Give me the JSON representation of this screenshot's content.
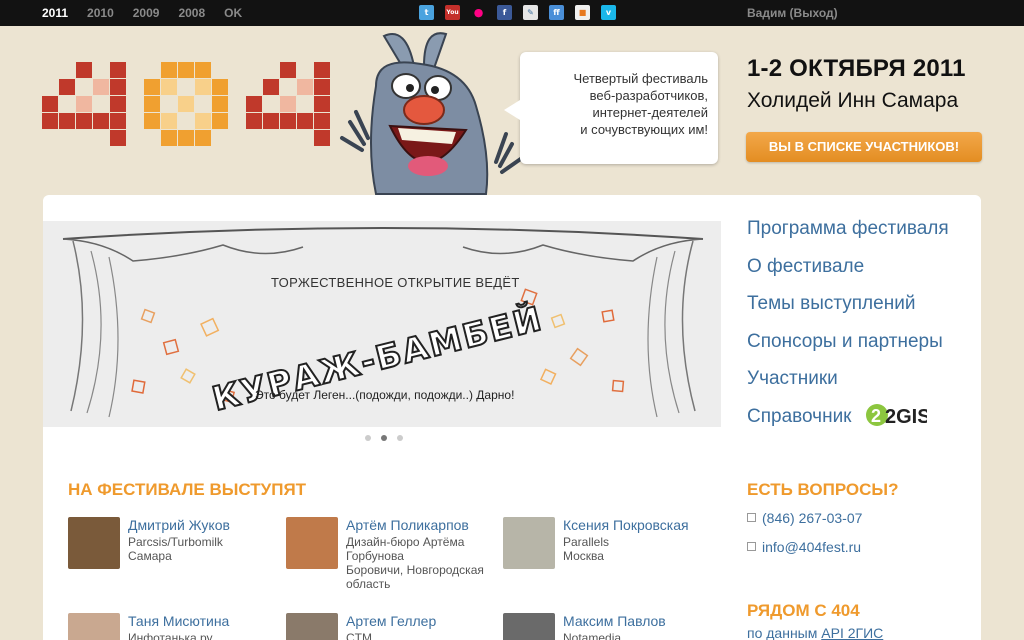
{
  "topbar": {
    "years": [
      "2011",
      "2010",
      "2009",
      "2008",
      "OK"
    ],
    "active_year": "2011",
    "social_icons": [
      "twitter-icon",
      "youtube-icon",
      "flickr-icon",
      "facebook-icon",
      "feather-icon",
      "friendfeed-icon",
      "blogger-icon",
      "vimeo-icon"
    ],
    "user_label": "Вадим (Выход)"
  },
  "header": {
    "logo_text": "404",
    "bubble": [
      "Четвертый фестиваль",
      "веб-разработчиков,",
      "интернет-деятелей",
      "и сочувствующих им!"
    ],
    "date": "1-2 ОКТЯБРЯ 2011",
    "venue": "Холидей Инн Самара",
    "register_button": "ВЫ В СПИСКЕ УЧАСТНИКОВ!"
  },
  "slider": {
    "title": "ТОРЖЕСТВЕННОЕ ОТКРЫТИЕ ВЕДЁТ",
    "name": "КУРАЖ-БАМБЕЙ",
    "caption": "Это будет Леген...(подожди, подожди..) Дарно!",
    "dots": 3,
    "active_dot": 1
  },
  "nav": {
    "items": [
      "Программа фестиваля",
      "О фестивале",
      "Темы выступлений",
      "Спонсоры и партнеры",
      "Участники",
      "Справочник"
    ],
    "gis_badge": "2GIS"
  },
  "speakers": {
    "heading": "НА ФЕСТИВАЛЕ ВЫСТУПЯТ",
    "items": [
      {
        "name": "Дмитрий Жуков",
        "company": "Parcsis/Turbomilk",
        "city": "Самара",
        "photo_color": "#7a5a3a"
      },
      {
        "name": "Артём Поликарпов",
        "company": "Дизайн-бюро Артёма Горбунова",
        "city": "Боровичи, Новгородская область",
        "photo_color": "#c07a4a"
      },
      {
        "name": "Ксения Покровская",
        "company": "Parallels",
        "city": "Москва",
        "photo_color": "#b7b5a8"
      },
      {
        "name": "Таня Мисютина",
        "company": "Инфотанька.ру",
        "city": "",
        "photo_color": "#c9a890"
      },
      {
        "name": "Артем Геллер",
        "company": "CTM",
        "city": "",
        "photo_color": "#8a7a6a"
      },
      {
        "name": "Максим Павлов",
        "company": "Notamedia",
        "city": "",
        "photo_color": "#6a6a6a"
      }
    ]
  },
  "contacts": {
    "heading": "ЕСТЬ ВОПРОСЫ?",
    "phone": "(846) 267-03-07",
    "email": "info@404fest.ru"
  },
  "nearby": {
    "heading": "РЯДОМ С 404",
    "sub_prefix": "по данным ",
    "sub_link": "API 2ГИС"
  }
}
